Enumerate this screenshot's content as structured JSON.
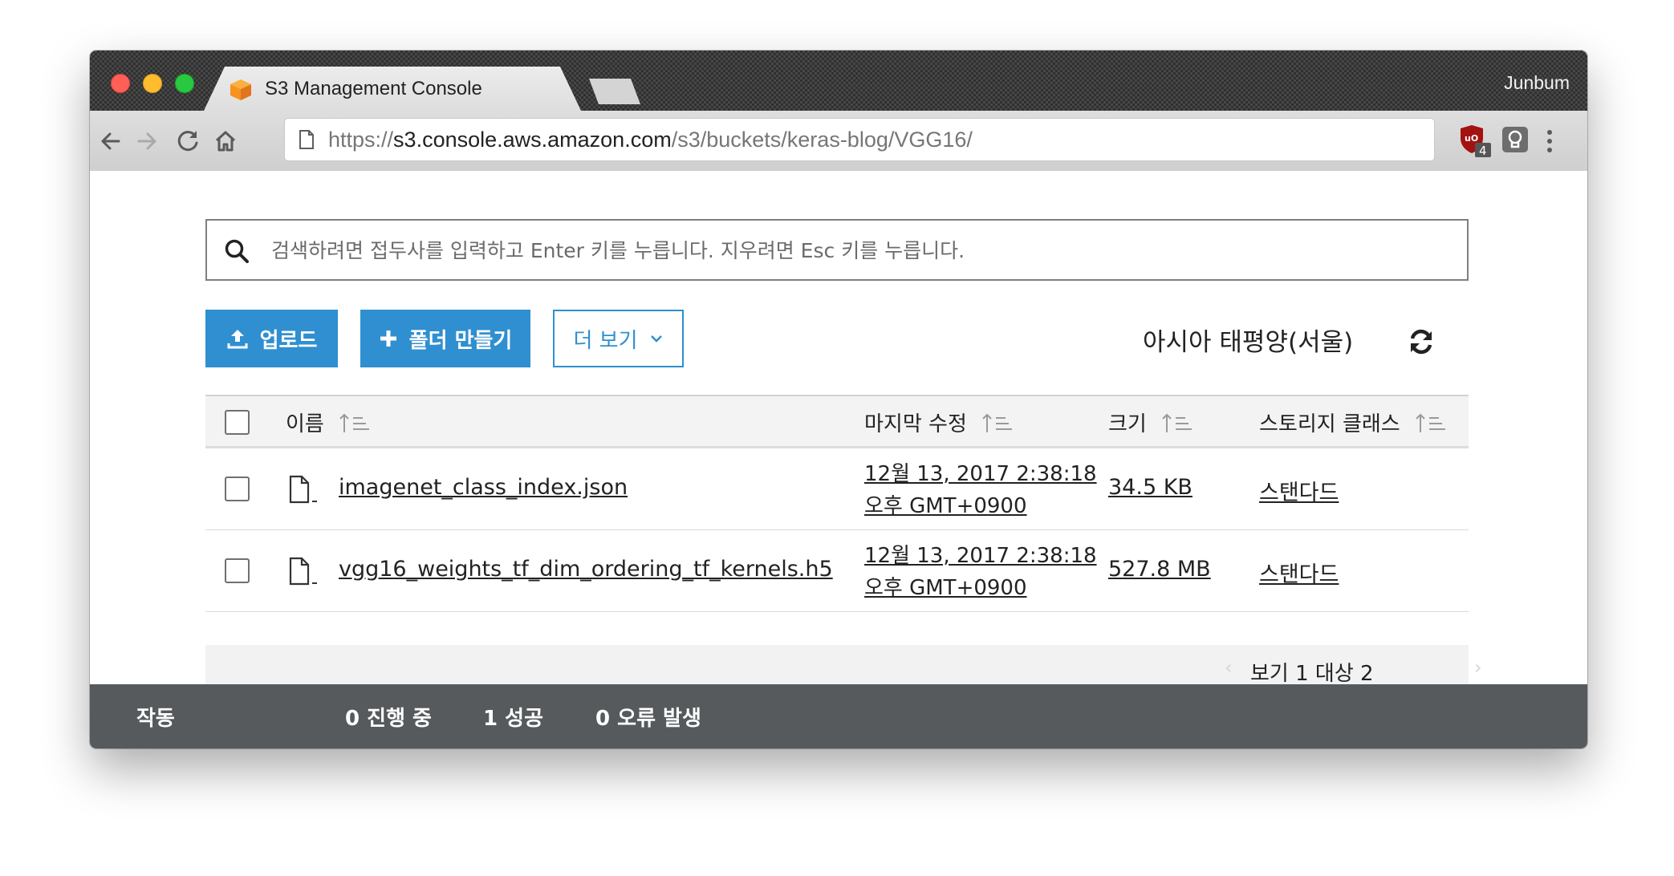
{
  "browser": {
    "tab_title": "S3 Management Console",
    "close_glyph": "×",
    "profile_name": "Junbum",
    "url_scheme": "https://",
    "url_host": "s3.console.aws.amazon.com",
    "url_path": "/s3/buckets/keras-blog/VGG16/",
    "extension_badge": "4",
    "icons": [
      "back-icon",
      "forward-icon",
      "reload-icon",
      "home-icon",
      "page-icon",
      "shield-extension-icon",
      "lightbulb-extension-icon",
      "menu-kebab-icon"
    ]
  },
  "search": {
    "placeholder": "검색하려면 접두사를 입력하고 Enter 키를 누릅니다. 지우려면 Esc 키를 누릅니다."
  },
  "actions": {
    "upload_label": "업로드",
    "create_folder_label": "폴더 만들기",
    "more_label": "더 보기"
  },
  "region": "아시아 태평양(서울)",
  "table": {
    "headers": {
      "name": "이름",
      "last_modified": "마지막 수정",
      "size": "크기",
      "storage_class": "스토리지 클래스"
    },
    "rows": [
      {
        "name": "imagenet_class_index.json",
        "modified_line1": "12월 13, 2017 2:38:18",
        "modified_line2": "오후 GMT+0900",
        "size": "34.5 KB",
        "storage_class": "스탠다드"
      },
      {
        "name": "vgg16_weights_tf_dim_ordering_tf_kernels.h5",
        "modified_line1": "12월 13, 2017 2:38:18",
        "modified_line2": "오후 GMT+0900",
        "size": "527.8 MB",
        "storage_class": "스탠다드"
      }
    ]
  },
  "pager": {
    "prev_glyph": "‹",
    "next_glyph": "›",
    "text": "보기 1 대상 2"
  },
  "status_bar": {
    "label": "작동",
    "in_progress": "0 진행 중",
    "success": "1 성공",
    "errors": "0 오류 발생"
  },
  "colors": {
    "primary_blue": "#2f8fd0",
    "status_bar_bg": "#565a5d",
    "favicon_orange": "#f7931e"
  }
}
